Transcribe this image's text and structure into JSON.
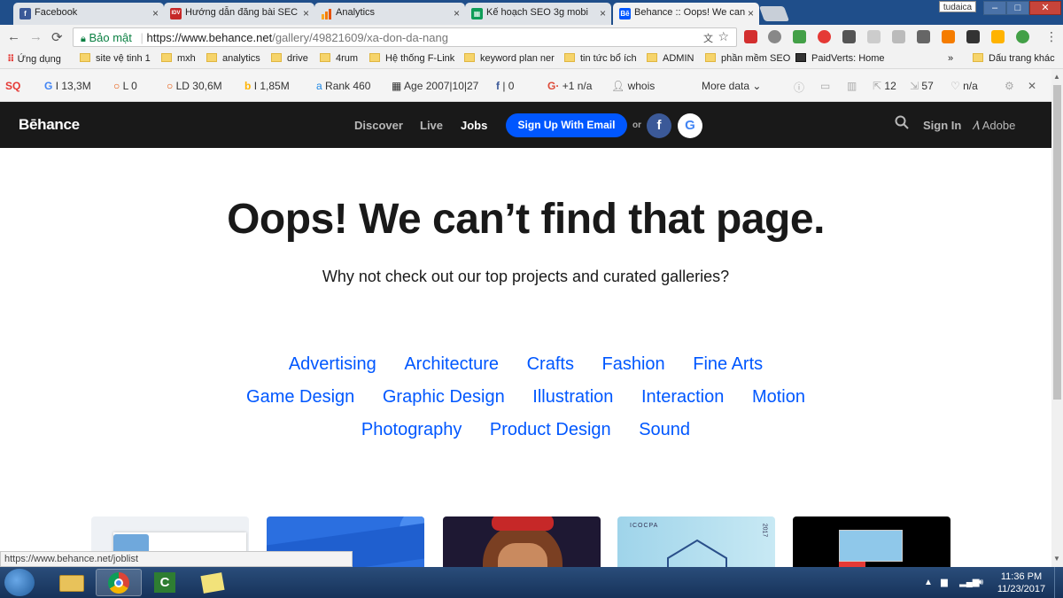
{
  "tabs": [
    {
      "title": "Facebook",
      "fav": "f",
      "fav_color": "#3b5998"
    },
    {
      "title": "Hướng dẫn đăng bài SEC",
      "fav": "IDV",
      "fav_color": "#c62828"
    },
    {
      "title": "Analytics",
      "fav": "",
      "fav_color": "#f57c00"
    },
    {
      "title": "Kế hoạch SEO 3g mobi",
      "fav": "",
      "fav_color": "#0f9d58"
    },
    {
      "title": "Behance :: Oops! We can",
      "fav": "Bē",
      "fav_color": "#0057ff"
    }
  ],
  "browser": {
    "profile": "tudaica",
    "secure_label": "Bảo mật",
    "url_host": "https://www.behance.net",
    "url_path": "/gallery/49821609/xa-don-da-nang"
  },
  "bookmarks": {
    "apps": "Ứng dụng",
    "items": [
      "site vệ tinh 1",
      "mxh",
      "analytics",
      "drive",
      "4rum",
      "Hệ thống F-Link",
      "keyword plan ner",
      "tin tức bổ ích",
      "ADMIN",
      "phần mềm SEO",
      "PaidVerts: Home"
    ],
    "more": "»",
    "other": "Dấu trang khác"
  },
  "seobar": {
    "g_index": "I 13,3M",
    "l": "L 0",
    "ld": "LD 30,6M",
    "b_index": "I 1,85M",
    "rank_label": "Rank",
    "rank": "460",
    "age_label": "Age",
    "age": "2007|10|27",
    "fb": "0",
    "gplus": "+1 n/a",
    "whois": "whois",
    "more": "More data",
    "v1": "12",
    "v2": "57",
    "v3": "n/a"
  },
  "behance": {
    "logo": "Bēhance",
    "nav": [
      "Discover",
      "Live",
      "Jobs"
    ],
    "signup": "Sign Up With Email",
    "or": "or",
    "fb": "f",
    "google": "G",
    "signin": "Sign In",
    "adobe": "Adobe"
  },
  "main": {
    "title": "Oops! We can’t find that page.",
    "subtitle": "Why not check out our top projects and curated galleries?",
    "categories_row1": [
      "Advertising",
      "Architecture",
      "Crafts",
      "Fashion",
      "Fine Arts"
    ],
    "categories_row2": [
      "Game Design",
      "Graphic Design",
      "Illustration",
      "Interaction",
      "Motion"
    ],
    "categories_row3": [
      "Photography",
      "Product Design",
      "Sound"
    ]
  },
  "thumbs": {
    "card4_text": "ICOCPA",
    "card4_year": "2017"
  },
  "status": "https://www.behance.net/joblist",
  "taskbar": {
    "time": "11:36 PM",
    "date": "11/23/2017"
  }
}
